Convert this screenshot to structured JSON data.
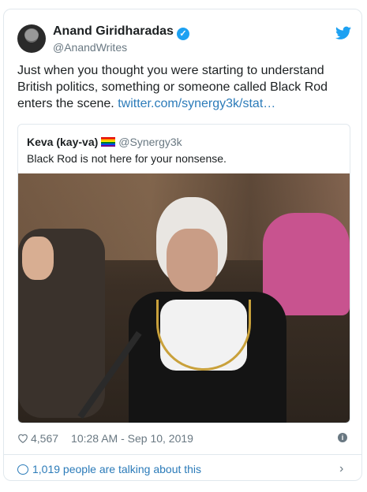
{
  "author": {
    "name": "Anand Giridharadas",
    "handle": "@AnandWrites",
    "verified_icon": "verified-badge-icon"
  },
  "tweet": {
    "text": "Just when you thought you were starting to understand British politics, something or someone called Black Rod enters the scene.",
    "link_text": "twitter.com/synergy3k/stat…"
  },
  "quote": {
    "name": "Keva (kay-va)",
    "flag_icon": "rainbow-flag-icon",
    "handle": "@Synergy3k",
    "text": "Black Rod is not here for your nonsense."
  },
  "meta": {
    "likes": "4,567",
    "timestamp": "10:28 AM - Sep 10, 2019"
  },
  "footer": {
    "talking_text": "1,019 people are talking about this"
  },
  "colors": {
    "accent": "#1da1f2",
    "link": "#2b7bb9",
    "muted": "#697882",
    "border": "#e1e8ed"
  }
}
